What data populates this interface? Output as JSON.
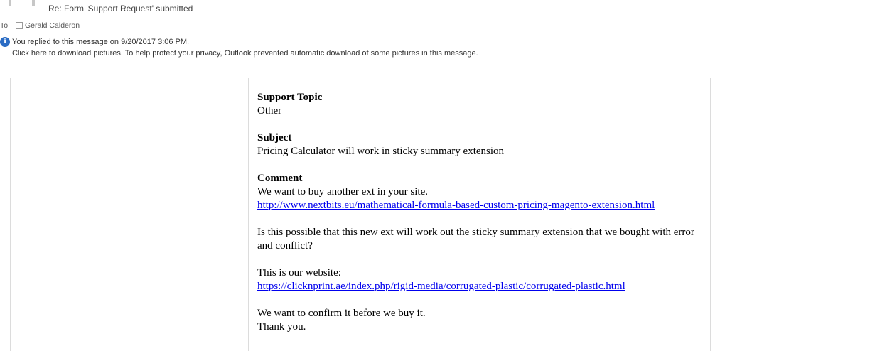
{
  "header": {
    "subject": "Re: Form 'Support Request' submitted",
    "to_label": "To",
    "recipient": "Gerald Calderon"
  },
  "infobar": {
    "replied_notice": "You replied to this message on 9/20/2017 3:06 PM.",
    "download_notice": "Click here to download pictures. To help protect your privacy, Outlook prevented automatic download of some pictures in this message."
  },
  "message": {
    "topic_label": "Support Topic",
    "topic_value": "Other",
    "subject_label": "Subject",
    "subject_value": "Pricing Calculator will work in sticky summary extension",
    "comment_label": "Comment",
    "comment_line1": "We want to buy another ext in your site.",
    "comment_link1": "http://www.nextbits.eu/mathematical-formula-based-custom-pricing-magento-extension.html",
    "comment_para2": "Is this possible that this new ext will work out the sticky summary extension that we bought with error and conflict?",
    "comment_line3": "This is our website:",
    "comment_link2": "https://clicknprint.ae/index.php/rigid-media/corrugated-plastic/corrugated-plastic.html",
    "comment_line4": "We want to confirm it before we buy it.",
    "comment_line5": "Thank you."
  }
}
